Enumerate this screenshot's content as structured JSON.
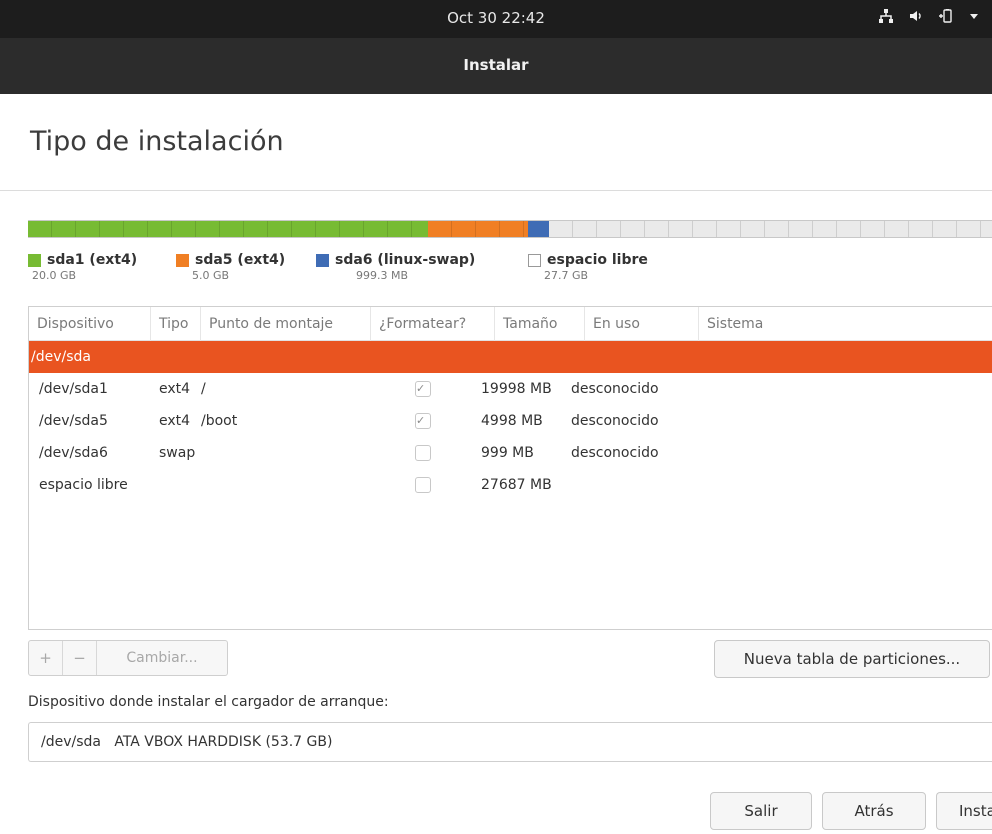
{
  "topbar": {
    "clock": "Oct 30  22:42",
    "icons": [
      "network-icon",
      "volume-icon",
      "battery-icon",
      "menu-caret-icon"
    ]
  },
  "window": {
    "title": "Instalar"
  },
  "page": {
    "heading": "Tipo de instalación"
  },
  "colors": {
    "accent": "#e95420",
    "sda1": "#77bb33",
    "sda5": "#f07f24",
    "sda6": "#3f6cb5",
    "free": "#eaeaea"
  },
  "partition_bar": {
    "segments": [
      {
        "id": "sda1",
        "fraction": 0.415
      },
      {
        "id": "sda5",
        "fraction": 0.104
      },
      {
        "id": "sda6",
        "fraction": 0.021
      },
      {
        "id": "free",
        "fraction": 0.46
      }
    ]
  },
  "legend": [
    {
      "name": "sda1 (ext4)",
      "size": "20.0 GB"
    },
    {
      "name": "sda5 (ext4)",
      "size": "5.0 GB"
    },
    {
      "name": "sda6 (linux-swap)",
      "size": "999.3 MB"
    },
    {
      "name": "espacio libre",
      "size": "27.7 GB"
    }
  ],
  "table": {
    "columns": [
      "Dispositivo",
      "Tipo",
      "Punto de montaje",
      "¿Formatear?",
      "Tamaño",
      "En uso",
      "Sistema"
    ],
    "selected_device": "/dev/sda",
    "rows": [
      {
        "device": "/dev/sda1",
        "type": "ext4",
        "mount": "/",
        "format": true,
        "size": "19998 MB",
        "used": "desconocido"
      },
      {
        "device": "/dev/sda5",
        "type": "ext4",
        "mount": "/boot",
        "format": true,
        "size": "4998 MB",
        "used": "desconocido"
      },
      {
        "device": "/dev/sda6",
        "type": "swap",
        "mount": "",
        "format": false,
        "size": "999 MB",
        "used": "desconocido"
      },
      {
        "device": "espacio libre",
        "type": "",
        "mount": "",
        "format": false,
        "size": "27687 MB",
        "used": ""
      }
    ]
  },
  "toolbar": {
    "add": "+",
    "remove": "−",
    "change": "Cambiar..."
  },
  "new_table_button": "Nueva tabla de particiones...",
  "bootloader": {
    "label": "Dispositivo donde instalar el cargador de arranque:",
    "value": "/dev/sda   ATA VBOX HARDDISK (53.7 GB)"
  },
  "buttons": {
    "quit": "Salir",
    "back": "Atrás",
    "install": "Instalar ahora"
  }
}
